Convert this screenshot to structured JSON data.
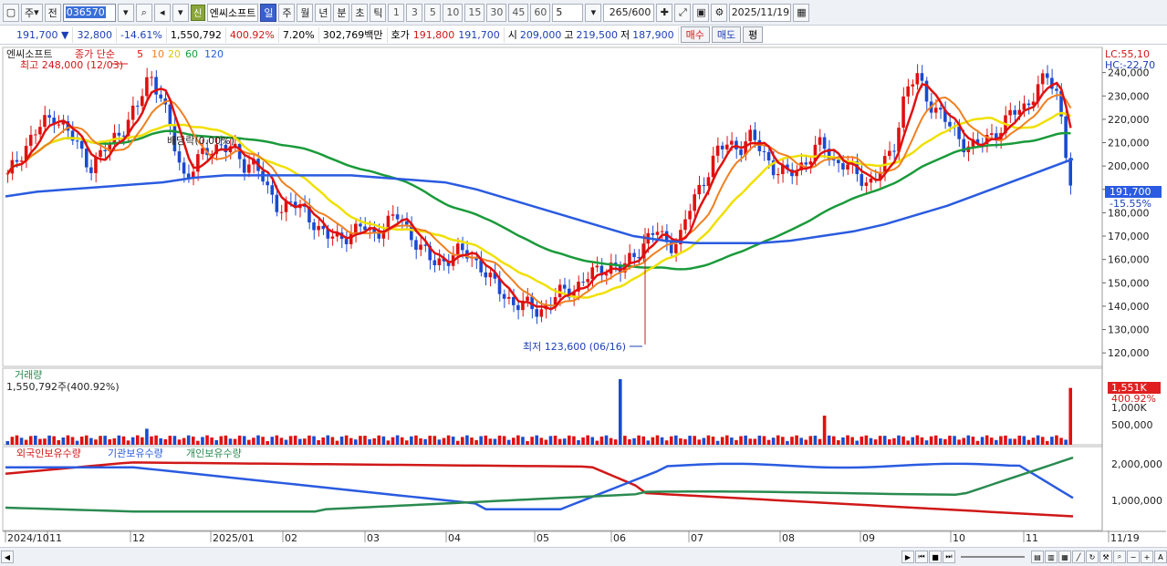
{
  "toolbar": {
    "market": "주",
    "prefix": "전",
    "code": "036570",
    "new_badge": "신",
    "stock_name": "엔씨소프트",
    "periods": [
      "일",
      "주",
      "월",
      "년",
      "분",
      "초",
      "틱"
    ],
    "active_period": "일",
    "intervals": [
      "1",
      "3",
      "5",
      "10",
      "15",
      "30",
      "45",
      "60"
    ],
    "interval_value": "5",
    "count": "265/600",
    "date": "2025/11/19"
  },
  "info": {
    "price": "191,700 ▼",
    "change": "32,800",
    "change_pct": "-14.61%",
    "volume": "1,550,792",
    "volume_pct": "400.92%",
    "turnover": "7.20%",
    "amount": "302,769백만",
    "quote_label": "호가",
    "bid": "191,800",
    "ask": "191,700",
    "open_label": "시",
    "open": "209,000",
    "high_label": "고",
    "high": "219,500",
    "low_label": "저",
    "low": "187,900",
    "buy_btn": "매수",
    "sell_btn": "매도",
    "eval_btn": "평"
  },
  "price_panel": {
    "legend_name": "엔씨소프트",
    "legend_type": "종가 단순",
    "ma_labels": [
      "5",
      "10",
      "20",
      "60",
      "120"
    ],
    "ma_colors": [
      "#e01010",
      "#f08020",
      "#f0e000",
      "#1a9a3a",
      "#2a5be0"
    ],
    "high_annot": "최고 248,000 (12/03)",
    "low_annot": "최저 123,600 (06/16)",
    "dividend_annot": "배당락(0.00%)",
    "lc": "LC:55,10",
    "hc": "HC:-22,70",
    "current_price": "191,700",
    "current_pct": "-15.55%",
    "y_ticks": [
      "240,000",
      "230,000",
      "220,000",
      "210,000",
      "200,000",
      "190,000",
      "180,000",
      "170,000",
      "160,000",
      "150,000",
      "140,000",
      "130,000",
      "120,000"
    ]
  },
  "volume_panel": {
    "title": "거래량",
    "value": "1,550,792주(400.92%)",
    "current": "1,551K",
    "current_pct": "400.92%",
    "y_ticks": [
      "1,000K",
      "500,000"
    ]
  },
  "holding_panel": {
    "labels": [
      "외국인보유수량",
      "기관보유수량",
      "개인보유수량"
    ],
    "colors": [
      "#d01818",
      "#2a5be0",
      "#2a8a50"
    ],
    "y_ticks": [
      "2,000,000",
      "1,000,000"
    ]
  },
  "x_axis": [
    "2024/10",
    "11",
    "12",
    "2025/01",
    "02",
    "03",
    "04",
    "05",
    "06",
    "07",
    "08",
    "09",
    "10",
    "11",
    "11/19"
  ],
  "chart_data": {
    "type": "candlestick",
    "title": "",
    "ylim": [
      115000,
      250000
    ],
    "high": {
      "value": 248000,
      "date": "12/03"
    },
    "low": {
      "value": 123600,
      "date": "06/16"
    },
    "close_series": [
      195000,
      205000,
      212000,
      218000,
      222000,
      215000,
      208000,
      200000,
      205000,
      212000,
      218000,
      225000,
      240000,
      230000,
      210000,
      195000,
      202000,
      206000,
      210000,
      207000,
      200000,
      203000,
      188000,
      182000,
      185000,
      180000,
      176000,
      170000,
      168000,
      172000,
      174000,
      170000,
      176000,
      178000,
      172000,
      165000,
      158000,
      160000,
      163000,
      162000,
      158000,
      150000,
      145000,
      141000,
      140000,
      138000,
      142000,
      146000,
      148000,
      152000,
      155000,
      158000,
      155000,
      162000,
      168000,
      172000,
      166000,
      170000,
      185000,
      195000,
      205000,
      210000,
      208000,
      212000,
      206000,
      198000,
      196000,
      200000,
      204000,
      210000,
      202000,
      200000,
      196000,
      193000,
      198000,
      208000,
      232000,
      238000,
      228000,
      222000,
      215000,
      210000,
      208000,
      212000,
      216000,
      222000,
      225000,
      232000,
      238000,
      230000,
      191700
    ],
    "ma120": [
      187000,
      189000,
      190000,
      191000,
      192000,
      193000,
      195000,
      196000,
      196000,
      196000,
      196000,
      196000,
      195000,
      194000,
      193000,
      190000,
      186000,
      182000,
      178000,
      174000,
      170000,
      168000,
      167000,
      167000,
      167000,
      168000,
      170000,
      172000,
      175000,
      179000,
      183000,
      188000,
      193000,
      198000,
      203000
    ]
  }
}
